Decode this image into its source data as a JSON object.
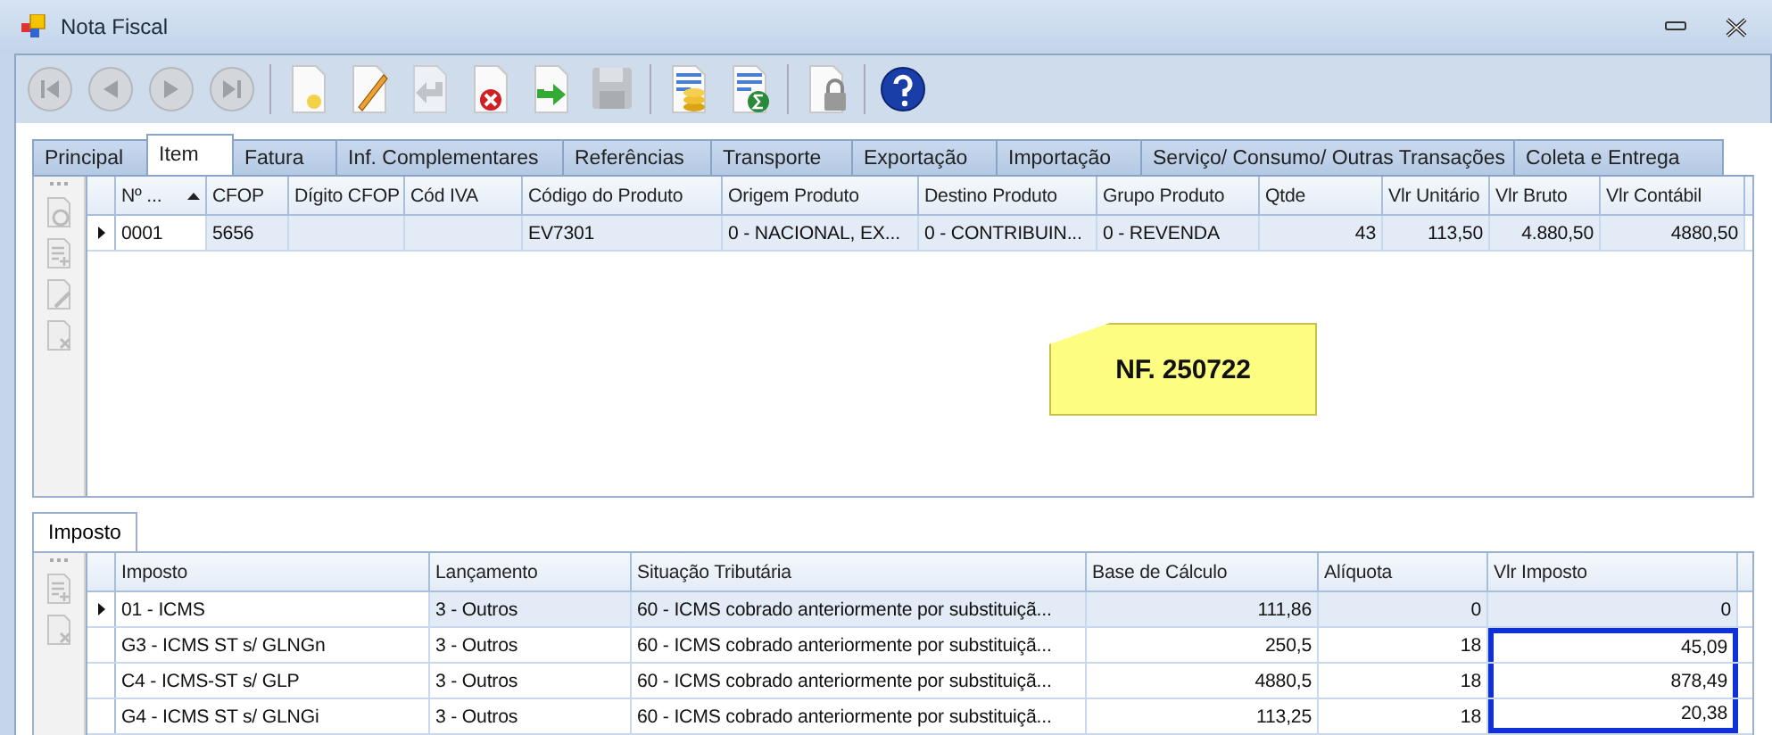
{
  "window": {
    "title": "Nota Fiscal"
  },
  "toolbar": [
    {
      "kind": "first",
      "disabled": true
    },
    {
      "kind": "prev",
      "disabled": true
    },
    {
      "kind": "next",
      "disabled": true
    },
    {
      "kind": "last",
      "disabled": true
    },
    {
      "kind": "sep"
    },
    {
      "kind": "new",
      "disabled": false
    },
    {
      "kind": "edit",
      "disabled": false
    },
    {
      "kind": "undo",
      "disabled": true
    },
    {
      "kind": "delete",
      "disabled": false
    },
    {
      "kind": "forward",
      "disabled": false
    },
    {
      "kind": "save",
      "disabled": true
    },
    {
      "kind": "sep"
    },
    {
      "kind": "coins",
      "disabled": false
    },
    {
      "kind": "sum",
      "disabled": false
    },
    {
      "kind": "sep"
    },
    {
      "kind": "lock",
      "disabled": false
    },
    {
      "kind": "sep"
    },
    {
      "kind": "help",
      "disabled": false
    }
  ],
  "tabs": [
    {
      "label": "Principal",
      "selected": false
    },
    {
      "label": "Item",
      "selected": true
    },
    {
      "label": "Fatura",
      "selected": false
    },
    {
      "label": "Inf. Complementares",
      "selected": false
    },
    {
      "label": "Referências",
      "selected": false
    },
    {
      "label": "Transporte",
      "selected": false
    },
    {
      "label": "Exportação",
      "selected": false
    },
    {
      "label": "Importação",
      "selected": false
    },
    {
      "label": "Serviço/ Consumo/ Outras Transações",
      "selected": false
    },
    {
      "label": "Coleta e Entrega",
      "selected": false
    }
  ],
  "items_table": {
    "columns": [
      "Nº ...",
      "CFOP",
      "Dígito CFOP",
      "Cód IVA",
      "Código do Produto",
      "Origem Produto",
      "Destino Produto",
      "Grupo Produto",
      "Qtde",
      "Vlr Unitário",
      "Vlr Bruto",
      "Vlr Contábil"
    ],
    "rows": [
      {
        "selected": true,
        "cells": [
          "0001",
          "5656",
          "",
          "",
          "EV7301",
          "0 - NACIONAL, EX...",
          "0 - CONTRIBUIN...",
          "0 - REVENDA",
          "43",
          "113,50",
          "4.880,50",
          "4880,50"
        ]
      }
    ]
  },
  "note": {
    "text": "NF. 250722"
  },
  "lower_tabs": [
    {
      "label": "Imposto",
      "selected": true
    }
  ],
  "tax_table": {
    "columns": [
      "Imposto",
      "Lançamento",
      "Situação Tributária",
      "Base de Cálculo",
      "Alíquota",
      "Vlr Imposto"
    ],
    "rows": [
      {
        "selected": true,
        "highlighted": false,
        "cells": [
          "01 - ICMS",
          "3 - Outros",
          "60 - ICMS cobrado anteriormente por substituiçã...",
          "111,86",
          "0",
          "0"
        ]
      },
      {
        "selected": false,
        "highlighted": true,
        "cells": [
          "G3 - ICMS ST s/ GLNGn",
          "3 - Outros",
          "60 - ICMS cobrado anteriormente por substituiçã...",
          "250,5",
          "18",
          "45,09"
        ]
      },
      {
        "selected": false,
        "highlighted": true,
        "cells": [
          "C4 - ICMS-ST s/ GLP",
          "3 - Outros",
          "60 - ICMS cobrado anteriormente por substituiçã...",
          "4880,5",
          "18",
          "878,49"
        ]
      },
      {
        "selected": false,
        "highlighted": true,
        "cells": [
          "G4 - ICMS ST s/ GLNGi",
          "3 - Outros",
          "60 - ICMS cobrado anteriormente por substituiçã...",
          "113,25",
          "18",
          "20,38"
        ]
      }
    ]
  }
}
